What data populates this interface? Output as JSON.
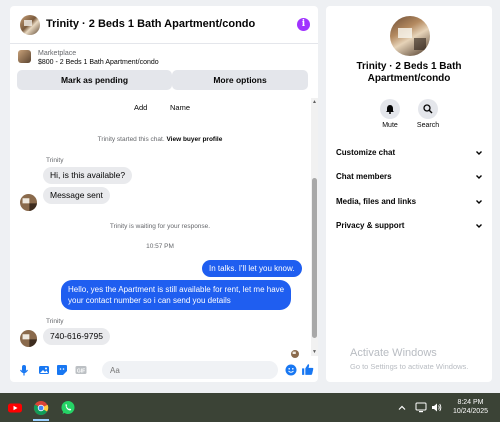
{
  "header": {
    "title": "Trinity · 2 Beds 1 Bath Apartment/condo"
  },
  "listing": {
    "source": "Marketplace",
    "title": "$800 - 2 Beds 1 Bath Apartment/condo"
  },
  "actions": {
    "mark_pending": "Mark as pending",
    "more_options": "More options"
  },
  "strip": {
    "add": "Add",
    "name": "Name"
  },
  "messages": {
    "started_prefix": "Trinity started this chat.",
    "view_profile": "View buyer profile",
    "sender1": "Trinity",
    "msg1": "Hi, is this available?",
    "msg2": "Message sent",
    "waiting": "Trinity is waiting for your response.",
    "time": "10:57 PM",
    "out1": "In talks. I'll let you know.",
    "out2_line1": "Hello, yes the Apartment is still available for rent, let me have",
    "out2_line2": "your contact number so i can send you details",
    "sender2": "Trinity",
    "msg3": "740-616-9795"
  },
  "composer": {
    "placeholder": "Aa"
  },
  "profile": {
    "name_line1": "Trinity · 2 Beds 1 Bath",
    "name_line2": "Apartment/condo",
    "mute": "Mute",
    "search": "Search"
  },
  "menu": [
    "Customize chat",
    "Chat members",
    "Media, files and links",
    "Privacy & support"
  ],
  "watermark": {
    "title": "Activate Windows",
    "subtitle": "Go to Settings to activate Windows."
  },
  "taskbar": {
    "time": "8:24 PM",
    "date": "10/24/2025"
  },
  "colors": {
    "messenger_blue": "#1f5ef0",
    "info_purple": "#a033ff",
    "taskbar": "#3b4336"
  }
}
